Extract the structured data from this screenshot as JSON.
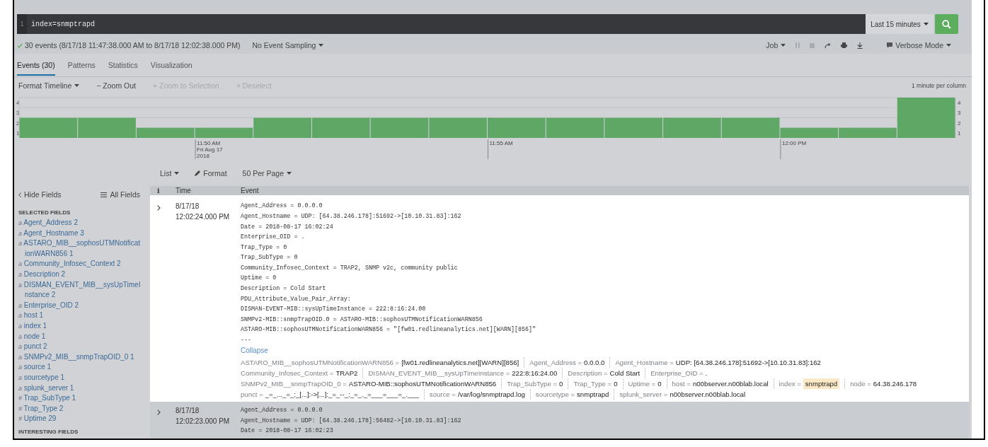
{
  "search": {
    "line_number": "1",
    "query": "index=snmptrapd",
    "time_range": "Last 15 minutes"
  },
  "status": {
    "text": "30 events (8/17/18 11:47:38.000 AM to 8/17/18 12:02:38.000 PM)",
    "sampling": "No Event Sampling",
    "job": "Job",
    "mode": "Verbose Mode"
  },
  "tabs": [
    {
      "label": "Events (30)",
      "selected": true
    },
    {
      "label": "Patterns",
      "selected": false
    },
    {
      "label": "Statistics",
      "selected": false
    },
    {
      "label": "Visualization",
      "selected": false
    }
  ],
  "timeline_toolbar": [
    {
      "label": "Format Timeline",
      "kind": "dropdown",
      "disabled": false
    },
    {
      "label": "− Zoom Out",
      "kind": "action",
      "disabled": false
    },
    {
      "label": "+ Zoom to Selection",
      "kind": "action",
      "disabled": true
    },
    {
      "label": "× Deselect",
      "kind": "action",
      "disabled": true
    }
  ],
  "timeline_scale": "1 minute per column",
  "timeline": {
    "chart_data": {
      "type": "bar",
      "categories": [
        null,
        null,
        null,
        "11:50 AM\nFri Aug 17\n2018",
        null,
        null,
        null,
        null,
        "11:55 AM",
        null,
        null,
        null,
        null,
        "12:00 PM",
        null,
        null
      ],
      "values": [
        2,
        2,
        1,
        1,
        2,
        2,
        2,
        2,
        2,
        2,
        2,
        2,
        2,
        1,
        1,
        4
      ],
      "ylim": [
        0,
        4
      ],
      "yticks": [
        1,
        2,
        3,
        4
      ],
      "y2ticks": [
        1,
        2,
        3,
        4
      ],
      "y2lim": [
        0,
        4
      ],
      "grid": true
    }
  },
  "results_toolbar": [
    {
      "label": "List",
      "kind": "dropdown"
    },
    {
      "label": "Format",
      "kind": "pencil"
    },
    {
      "label": "50 Per Page",
      "kind": "dropdown"
    }
  ],
  "sidebar": {
    "hide_fields": "Hide Fields",
    "all_fields": "All Fields",
    "section": "SELECTED FIELDS",
    "fields": [
      {
        "type": "a",
        "name": "Agent_Address",
        "count": "2"
      },
      {
        "type": "a",
        "name": "Agent_Hostname",
        "count": "3"
      },
      {
        "type": "a",
        "name": "ASTARO_MIB__sophosUTMNotificationWARN856",
        "count": "1"
      },
      {
        "type": "a",
        "name": "Community_Infosec_Context",
        "count": "2"
      },
      {
        "type": "a",
        "name": "Description",
        "count": "2"
      },
      {
        "type": "a",
        "name": "DISMAN_EVENT_MIB__sysUpTimeInstance",
        "count": "2"
      },
      {
        "type": "a",
        "name": "Enterprise_OID",
        "count": "2"
      },
      {
        "type": "a",
        "name": "host",
        "count": "1"
      },
      {
        "type": "a",
        "name": "index",
        "count": "1"
      },
      {
        "type": "a",
        "name": "node",
        "count": "1"
      },
      {
        "type": "a",
        "name": "punct",
        "count": "2"
      },
      {
        "type": "a",
        "name": "SNMPv2_MIB__snmpTrapOID_0",
        "count": "1"
      },
      {
        "type": "a",
        "name": "source",
        "count": "1"
      },
      {
        "type": "a",
        "name": "sourcetype",
        "count": "1"
      },
      {
        "type": "a",
        "name": "splunk_server",
        "count": "1"
      },
      {
        "type": "#",
        "name": "Trap_SubType",
        "count": "1"
      },
      {
        "type": "#",
        "name": "Trap_Type",
        "count": "2"
      },
      {
        "type": "#",
        "name": "Uptime",
        "count": "29"
      }
    ],
    "section_2": "INTERESTING FIELDS"
  },
  "table": {
    "columns": [
      "i",
      "Time",
      "Event"
    ],
    "rows": [
      {
        "date": "8/17/18",
        "time": "12:02:24.000 PM",
        "lines": [
          "Agent_Address = 0.0.0.0",
          "Agent_Hostname = UDP: [64.38.246.178]:51692->[10.10.31.83]:162",
          "Date = 2018-08-17 16:02:24",
          "Enterprise_OID = .",
          "Trap_Type = 0",
          "Trap_SubType = 0",
          "Community_Infosec_Context = TRAP2, SNMP v2c, community public",
          "Uptime = 0",
          "Description = Cold Start",
          "PDU_Attribute_Value_Pair_Array:",
          "DISMAN-EVENT-MIB::sysUpTimeInstance = 222:8:16:24.00",
          "SNMPv2-MIB::snmpTrapOID.0 = ASTARO-MIB::sophosUTMNotificationWARN856",
          "ASTARO-MIB::sophosUTMNotificationWARN856 = \"[fw01.redlineanalytics.net][WARN][856]\"",
          "---"
        ],
        "collapse": "Collapse",
        "field_rows": [
          [
            {
              "key": "ASTARO_MIB__sophosUTMNotificationWARN856 =",
              "value": "[fw01.redlineanalytics.net][WARN][856]",
              "highlighted": false
            },
            {
              "key": "Agent_Address =",
              "value": "0.0.0.0",
              "highlighted": false
            },
            {
              "key": "Agent_Hostname =",
              "value": "UDP: [64.38.246.178]:51692->[10.10.31.83]:162",
              "highlighted": false
            }
          ],
          [
            {
              "key": "Community_Infosec_Context =",
              "value": "TRAP2",
              "highlighted": false
            },
            {
              "key": "DISMAN_EVENT_MIB__sysUpTimeInstance =",
              "value": "222:8:16:24.00",
              "highlighted": false
            },
            {
              "key": "Description =",
              "value": "Cold Start",
              "highlighted": false
            },
            {
              "key": "Enterprise_OID =",
              "value": ".",
              "highlighted": false
            }
          ],
          [
            {
              "key": "SNMPv2_MIB__snmpTrapOID_0 =",
              "value": "ASTARO-MIB::sophosUTMNotificationWARN856",
              "highlighted": false
            },
            {
              "key": "Trap_SubType =",
              "value": "0",
              "highlighted": false
            },
            {
              "key": "Trap_Type =",
              "value": "0",
              "highlighted": false
            },
            {
              "key": "Uptime =",
              "value": "0",
              "highlighted": false
            },
            {
              "key": "host =",
              "value": "n00bserver.n00blab.local",
              "highlighted": false
            },
            {
              "key": "index =",
              "value": "snmptrapd",
              "highlighted": true
            },
            {
              "key": "node =",
              "value": "64.38.246.178",
              "highlighted": false
            }
          ],
          [
            {
              "key": "punct =",
              "value": "_=_..._=_:_[...]:->[...]:_=_--_:_=_._=___=___=_.___",
              "highlighted": false
            },
            {
              "key": "source =",
              "value": "/var/log/snmptrapd.log",
              "highlighted": false
            },
            {
              "key": "sourcetype =",
              "value": "snmptrapd",
              "highlighted": false
            },
            {
              "key": "splunk_server =",
              "value": "n00bserver.n00blab.local",
              "highlighted": false
            }
          ]
        ]
      },
      {
        "date": "8/17/18",
        "time": "12:02:23.000 PM",
        "lines": [
          "Agent_Address = 0.0.0.0",
          "Agent_Hostname = UDP: [64.38.246.178]:56482->[10.10.31.83]:162",
          "Date = 2018-08-17 16:02:23"
        ]
      }
    ]
  }
}
